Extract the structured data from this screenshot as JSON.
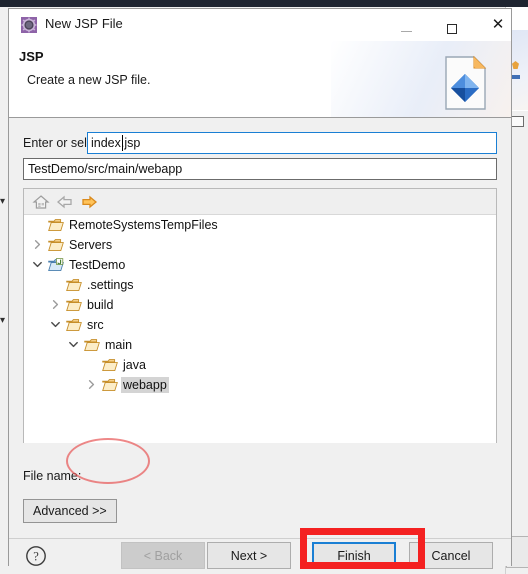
{
  "window": {
    "title": "New JSP File",
    "title_icon": "gear-icon",
    "minimize_label": "—",
    "maximize_label": "□",
    "close_label": "✕"
  },
  "header": {
    "title": "JSP",
    "description": "Create a new JSP file.",
    "banner_icon": "jsp-file-icon"
  },
  "form": {
    "parent_folder_label": "Enter or select the parent folder:",
    "parent_folder_value": "TestDemo/src/main/webapp",
    "file_name_label": "File name:",
    "file_name_value": "index.jsp",
    "advanced_label": "Advanced >>"
  },
  "tree_toolbar": {
    "home_icon": "home-icon",
    "back_icon": "arrow-left-icon",
    "forward_icon": "arrow-right-icon"
  },
  "tree": {
    "items": [
      {
        "label": "RemoteSystemsTempFiles",
        "depth": 1,
        "twisty": "none",
        "icon": "folder-icon",
        "selected": false
      },
      {
        "label": "Servers",
        "depth": 1,
        "twisty": "collapsed",
        "icon": "folder-icon",
        "selected": false
      },
      {
        "label": "TestDemo",
        "depth": 1,
        "twisty": "expanded",
        "icon": "project-icon",
        "selected": false
      },
      {
        "label": ".settings",
        "depth": 2,
        "twisty": "none",
        "icon": "folder-icon",
        "selected": false
      },
      {
        "label": "build",
        "depth": 2,
        "twisty": "collapsed",
        "icon": "folder-icon",
        "selected": false
      },
      {
        "label": "src",
        "depth": 2,
        "twisty": "expanded",
        "icon": "folder-icon",
        "selected": false
      },
      {
        "label": "main",
        "depth": 3,
        "twisty": "expanded",
        "icon": "folder-icon",
        "selected": false
      },
      {
        "label": "java",
        "depth": 4,
        "twisty": "none",
        "icon": "folder-icon",
        "selected": false
      },
      {
        "label": "webapp",
        "depth": 4,
        "twisty": "collapsed",
        "icon": "folder-icon",
        "selected": true
      }
    ]
  },
  "footer": {
    "help_icon": "help-icon",
    "back_label": "< Back",
    "next_label": "Next >",
    "finish_label": "Finish",
    "cancel_label": "Cancel"
  },
  "annotations": {
    "ellipse_target": "file-name-field",
    "rect_target": "finish-button",
    "color": "#f42121"
  },
  "colors": {
    "accent_blue": "#1a7fd4",
    "annotation_red": "#f42121",
    "folder_orange": "#e8a33d",
    "dialog_bg": "#f0f0f0"
  }
}
